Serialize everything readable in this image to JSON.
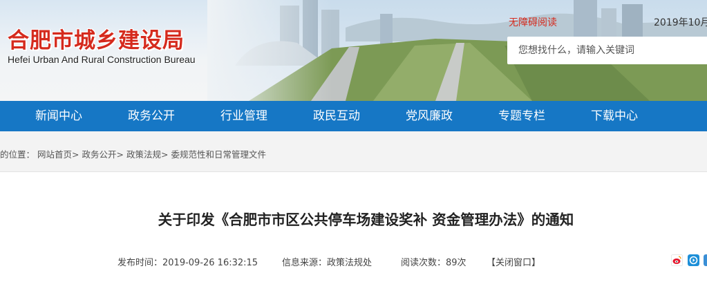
{
  "header": {
    "logo_cn": "合肥市城乡建设局",
    "logo_en": "Hefei Urban And Rural Construction Bureau",
    "accessibility_link": "无障碍阅读",
    "date": "2019年10月",
    "search": {
      "placeholder": "您想找什么，请输入关键词"
    }
  },
  "nav": {
    "items": [
      {
        "label": "新闻中心"
      },
      {
        "label": "政务公开"
      },
      {
        "label": "行业管理"
      },
      {
        "label": "政民互动"
      },
      {
        "label": "党风廉政"
      },
      {
        "label": "专题专栏"
      },
      {
        "label": "下载中心"
      }
    ]
  },
  "breadcrumb": {
    "prefix": "的位置：",
    "items": [
      {
        "label": "网站首页"
      },
      {
        "label": "政务公开"
      },
      {
        "label": "政策法规"
      },
      {
        "label": "委规范性和日常管理文件"
      }
    ],
    "separator": ">"
  },
  "article": {
    "title": "关于印发《合肥市市区公共停车场建设奖补 资金管理办法》的通知",
    "publish_time": "发布时间：2019-09-26 16:32:15",
    "source": "信息来源：政策法规处",
    "views": "阅读次数：89次",
    "close_window": "【关闭窗口】"
  },
  "share": {
    "icons": [
      "weibo-icon",
      "qzone-icon"
    ],
    "colors": {
      "weibo": "#e6162d",
      "qzone": "#1d8fd8"
    }
  },
  "colors": {
    "brand_red": "#d52a1d",
    "nav_blue": "#1677c5"
  }
}
